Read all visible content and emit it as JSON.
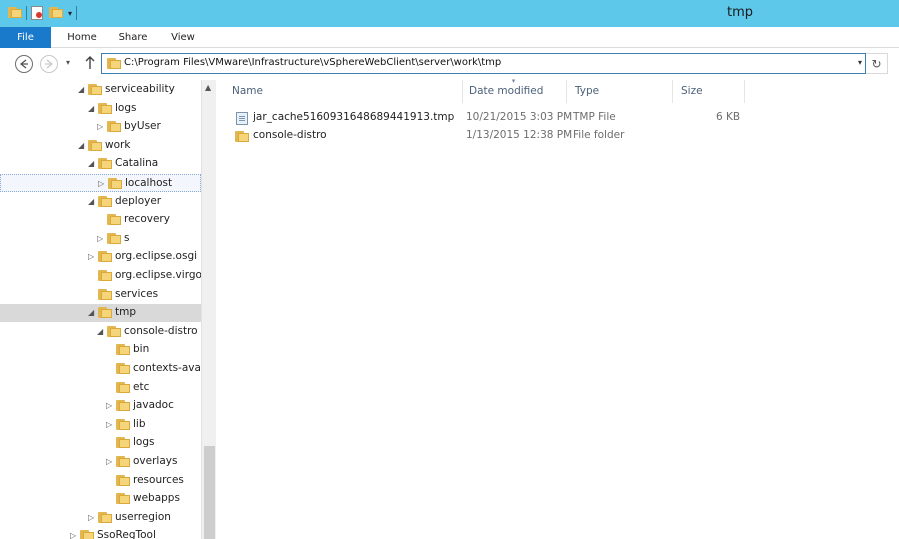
{
  "window": {
    "title": "tmp"
  },
  "ribbon": {
    "tabs": [
      "File",
      "Home",
      "Share",
      "View"
    ]
  },
  "address": {
    "path": "C:\\Program Files\\VMware\\Infrastructure\\vSphereWebClient\\server\\work\\tmp"
  },
  "tree": [
    {
      "label": "serviceability",
      "level": 1,
      "arrow": "expanded"
    },
    {
      "label": "logs",
      "level": 2,
      "arrow": "expanded"
    },
    {
      "label": "byUser",
      "level": 3,
      "arrow": "collapsed"
    },
    {
      "label": "work",
      "level": 1,
      "arrow": "expanded"
    },
    {
      "label": "Catalina",
      "level": 2,
      "arrow": "expanded"
    },
    {
      "label": "localhost",
      "level": 3,
      "arrow": "collapsed",
      "state": "hover"
    },
    {
      "label": "deployer",
      "level": 2,
      "arrow": "expanded"
    },
    {
      "label": "recovery",
      "level": 3,
      "arrow": "none"
    },
    {
      "label": "s",
      "level": 3,
      "arrow": "collapsed"
    },
    {
      "label": "org.eclipse.osgi",
      "level": 2,
      "arrow": "collapsed"
    },
    {
      "label": "org.eclipse.virgo.sh",
      "level": 2,
      "arrow": "none"
    },
    {
      "label": "services",
      "level": 2,
      "arrow": "none"
    },
    {
      "label": "tmp",
      "level": 2,
      "arrow": "expanded",
      "state": "selected"
    },
    {
      "label": "console-distro",
      "level": 3,
      "arrow": "expanded"
    },
    {
      "label": "bin",
      "level": 4,
      "arrow": "none"
    },
    {
      "label": "contexts-availa",
      "level": 4,
      "arrow": "none"
    },
    {
      "label": "etc",
      "level": 4,
      "arrow": "none"
    },
    {
      "label": "javadoc",
      "level": 4,
      "arrow": "collapsed"
    },
    {
      "label": "lib",
      "level": 4,
      "arrow": "collapsed"
    },
    {
      "label": "logs",
      "level": 4,
      "arrow": "none"
    },
    {
      "label": "overlays",
      "level": 4,
      "arrow": "collapsed"
    },
    {
      "label": "resources",
      "level": 4,
      "arrow": "none"
    },
    {
      "label": "webapps",
      "level": 4,
      "arrow": "none"
    },
    {
      "label": "userregion",
      "level": 2,
      "arrow": "collapsed"
    },
    {
      "label": "SsoRegTool",
      "level": 0,
      "arrow": "collapsed"
    }
  ],
  "columns": {
    "name": "Name",
    "date": "Date modified",
    "type": "Type",
    "size": "Size"
  },
  "files": [
    {
      "name": "jar_cache5160931648689441913.tmp",
      "date": "10/21/2015 3:03 PM",
      "type": "TMP File",
      "size": "6 KB",
      "icon": "file-icon"
    },
    {
      "name": "console-distro",
      "date": "1/13/2015 12:38 PM",
      "type": "File folder",
      "size": "",
      "icon": "folder-icon"
    }
  ],
  "colors": {
    "titlebar": "#5ec8eb",
    "file_tab": "#1979ca",
    "folder": "#f5d47a"
  }
}
